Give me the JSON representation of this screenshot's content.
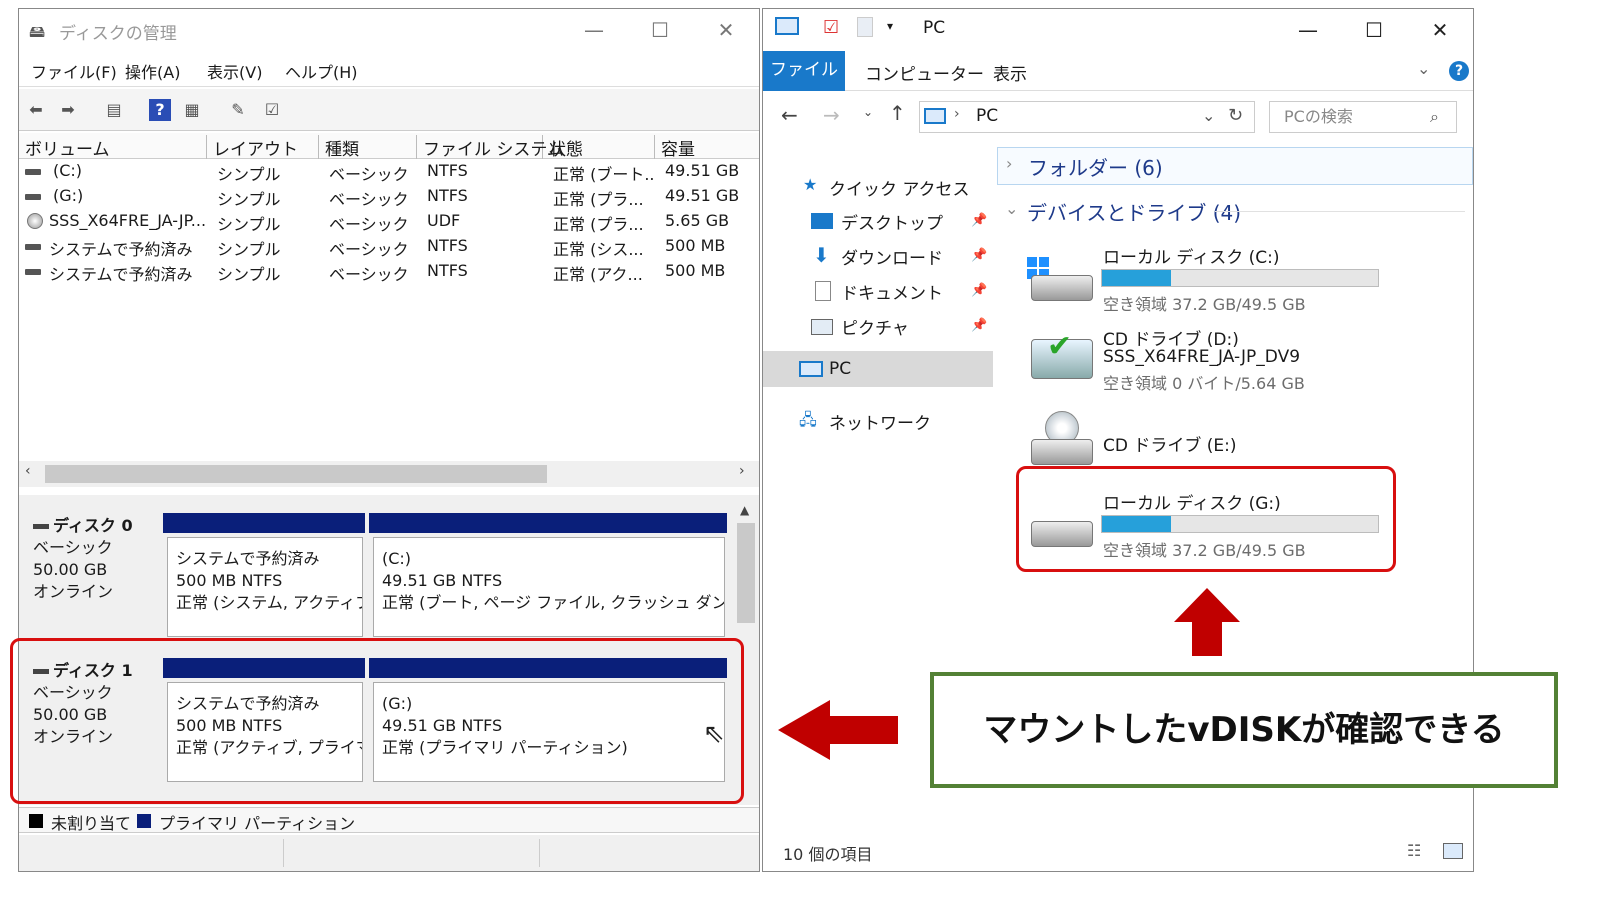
{
  "diskmgmt": {
    "title": "ディスクの管理",
    "menu": [
      "ファイル(F)",
      "操作(A)",
      "表示(V)",
      "ヘルプ(H)"
    ],
    "columns": [
      "ボリューム",
      "レイアウト",
      "種類",
      "ファイル システム",
      "状態",
      "容量"
    ],
    "rows": [
      [
        "(C:)",
        "シンプル",
        "ベーシック",
        "NTFS",
        "正常 (ブート...",
        "49.51 GB"
      ],
      [
        "(G:)",
        "シンプル",
        "ベーシック",
        "NTFS",
        "正常 (プラ...",
        "49.51 GB"
      ],
      [
        "SSS_X64FRE_JA-JP...",
        "シンプル",
        "ベーシック",
        "UDF",
        "正常 (プラ...",
        "5.65 GB"
      ],
      [
        "システムで予約済み",
        "シンプル",
        "ベーシック",
        "NTFS",
        "正常 (シス...",
        "500 MB"
      ],
      [
        "システムで予約済み",
        "シンプル",
        "ベーシック",
        "NTFS",
        "正常 (アク...",
        "500 MB"
      ]
    ],
    "disks": [
      {
        "name": "ディスク 0",
        "type": "ベーシック",
        "size": "50.00 GB",
        "status": "オンライン",
        "p1": {
          "l1": "システムで予約済み",
          "l2": "500 MB NTFS",
          "l3": "正常 (システム, アクティブ, :"
        },
        "p2": {
          "l1": "(C:)",
          "l2": "49.51 GB NTFS",
          "l3": "正常 (ブート, ページ ファイル, クラッシュ ダンプ, プラ"
        }
      },
      {
        "name": "ディスク 1",
        "type": "ベーシック",
        "size": "50.00 GB",
        "status": "オンライン",
        "p1": {
          "l1": "システムで予約済み",
          "l2": "500 MB NTFS",
          "l3": "正常 (アクティブ, プライマリ"
        },
        "p2": {
          "l1": "(G:)",
          "l2": "49.51 GB NTFS",
          "l3": "正常 (プライマリ パーティション)"
        }
      }
    ],
    "legend": [
      "未割り当て",
      "プライマリ パーティション"
    ],
    "colors": {
      "unallocated": "#000000",
      "primary": "#0a1f7a"
    }
  },
  "explorer": {
    "title": "PC",
    "tabs": [
      "ファイル",
      "コンピューター",
      "表示"
    ],
    "address": "PC",
    "search_placeholder": "PCの検索",
    "nav": {
      "quick": "クイック アクセス",
      "items": [
        "デスクトップ",
        "ダウンロード",
        "ドキュメント",
        "ピクチャ"
      ],
      "pc": "PC",
      "network": "ネットワーク"
    },
    "folders_group": "フォルダー (6)",
    "devices_group": "デバイスとドライブ (4)",
    "drives": [
      {
        "name": "ローカル ディスク (C:)",
        "free": "空き領域 37.2 GB/49.5 GB",
        "used_fraction": 0.25
      },
      {
        "name": "CD ドライブ (D:)",
        "label": "SSS_X64FRE_JA-JP_DV9",
        "free": "空き領域 0 バイト/5.64 GB"
      },
      {
        "name": "CD ドライブ (E:)"
      },
      {
        "name": "ローカル ディスク (G:)",
        "free": "空き領域 37.2 GB/49.5 GB",
        "used_fraction": 0.25
      }
    ],
    "status": "10 個の項目",
    "accent": "#1979ca"
  },
  "annotation": {
    "text": "マウントしたvDISKが確認できる",
    "box_color": "#d80f0f",
    "note_border": "#538135"
  }
}
